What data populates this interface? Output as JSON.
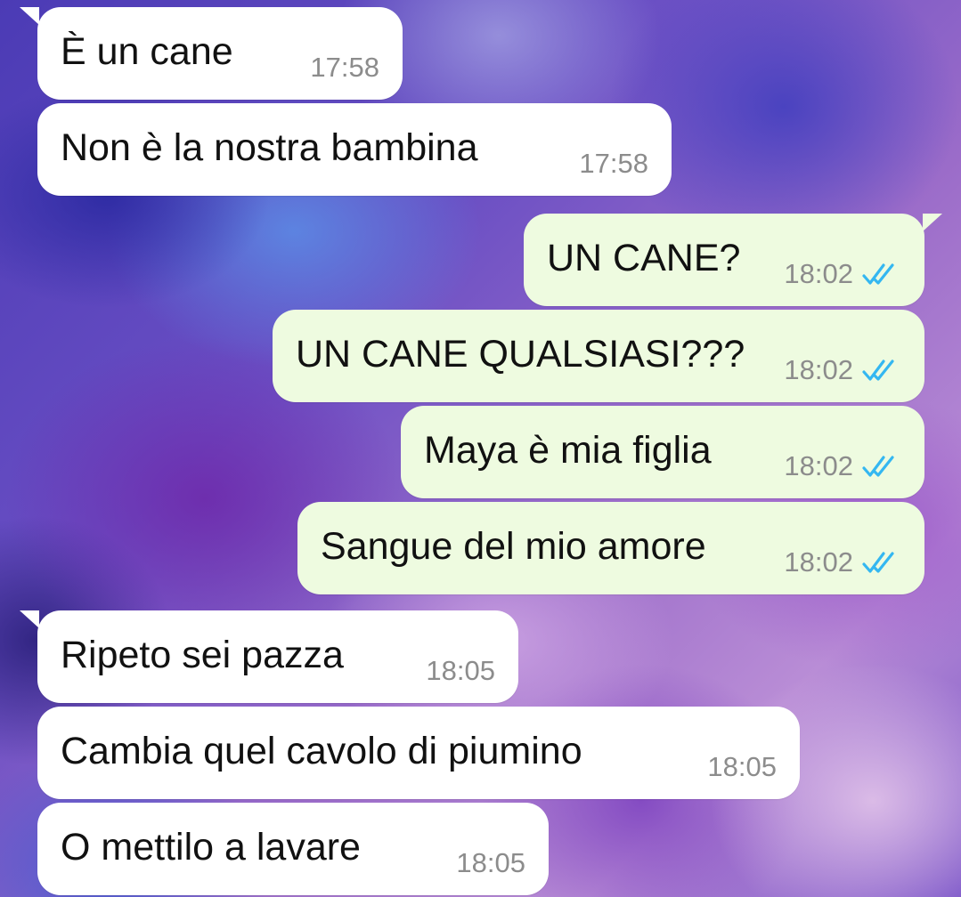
{
  "chat": {
    "messages": [
      {
        "direction": "incoming",
        "text": "È un cane",
        "time": "17:58"
      },
      {
        "direction": "incoming",
        "text": "Non è la nostra bambina",
        "time": "17:58"
      },
      {
        "direction": "outgoing",
        "text": "UN CANE?",
        "time": "18:02",
        "status_icon": "double-check-read-icon"
      },
      {
        "direction": "outgoing",
        "text": "UN CANE QUALSIASI???",
        "time": "18:02",
        "status_icon": "double-check-read-icon"
      },
      {
        "direction": "outgoing",
        "text": "Maya è mia figlia",
        "time": "18:02",
        "status_icon": "double-check-read-icon"
      },
      {
        "direction": "outgoing",
        "text": "Sangue del mio amore",
        "time": "18:02",
        "status_icon": "double-check-read-icon"
      },
      {
        "direction": "incoming",
        "text": "Ripeto sei pazza",
        "time": "18:05"
      },
      {
        "direction": "incoming",
        "text": "Cambia quel cavolo di piumino",
        "time": "18:05"
      },
      {
        "direction": "incoming",
        "text": "O mettilo a lavare",
        "time": "18:05"
      }
    ]
  },
  "colors": {
    "incoming_bubble": "#ffffff",
    "outgoing_bubble": "#eefbe0",
    "read_ticks": "#34b7f1",
    "time_text": "#8c8c8c"
  }
}
